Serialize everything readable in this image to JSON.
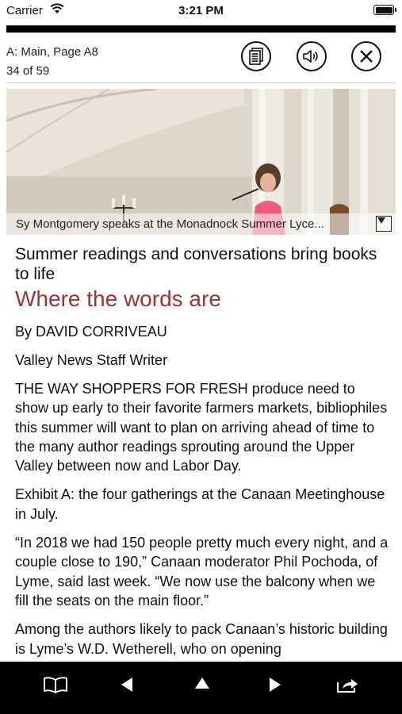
{
  "status_bar": {
    "carrier": "Carrier",
    "time": "3:21 PM"
  },
  "header": {
    "section_page": "A: Main, Page A8",
    "position": "34 of 59",
    "buttons": [
      "text-view-icon",
      "audio-icon",
      "close-icon"
    ]
  },
  "reading_progress": 0.576,
  "photo": {
    "caption": "Sy Montgomery speaks at the Monadnock Summer Lyce..."
  },
  "article": {
    "subhead": "Summer readings and conversations bring books to life",
    "headline": "Where the words are",
    "byline": "By DAVID CORRIVEAU",
    "staff_line": "Valley News Staff Writer",
    "paragraphs": [
      "THE WAY SHOPPERS FOR FRESH produce need to show up early to their favorite farmers markets, bibliophiles this summer will want to plan on arriving ahead of time to the many author readings sprouting around the Upper Valley between now and Labor Day.",
      "Exhibit A: the four gatherings at the Canaan Meetinghouse in July.",
      "“In 2018 we had 150 people pretty much every night, and a couple close to 190,” Canaan moderator Phil Pochoda, of Lyme, said last week. “We now use the balcony when we fill the seats on the main floor.”",
      "Among the authors likely to pack Canaan’s historic building is Lyme’s W.D. Wetherell, who on opening"
    ]
  },
  "toolbar": {
    "buttons": [
      "book-icon",
      "previous-icon",
      "up-icon",
      "next-icon",
      "share-icon"
    ]
  },
  "colors": {
    "headline": "#9a3434",
    "toolbar_bg": "#000000"
  }
}
